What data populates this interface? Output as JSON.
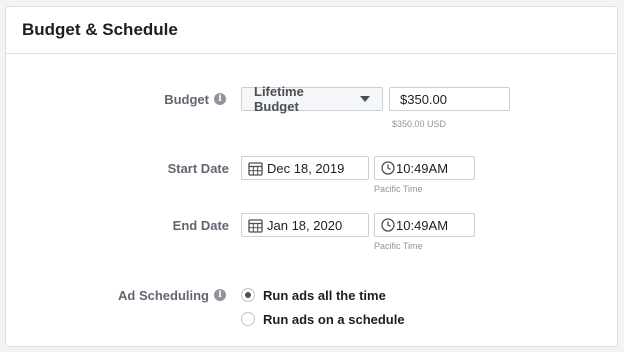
{
  "panel": {
    "title": "Budget & Schedule"
  },
  "budget": {
    "label": "Budget",
    "type_select": "Lifetime Budget",
    "amount": "$350.00",
    "amount_hint": "$350.00 USD"
  },
  "start": {
    "label": "Start Date",
    "date": "Dec 18, 2019",
    "time": "10:49AM",
    "timezone": "Pacific Time"
  },
  "end": {
    "label": "End Date",
    "date": "Jan 18, 2020",
    "time": "10:49AM",
    "timezone": "Pacific Time"
  },
  "scheduling": {
    "label": "Ad Scheduling",
    "options": [
      {
        "label": "Run ads all the time",
        "selected": true
      },
      {
        "label": "Run ads on a schedule",
        "selected": false
      }
    ]
  },
  "icons": [
    "info-icon",
    "caret-down-icon",
    "calendar-icon",
    "clock-icon",
    "radio-selected-icon",
    "radio-empty-icon"
  ]
}
